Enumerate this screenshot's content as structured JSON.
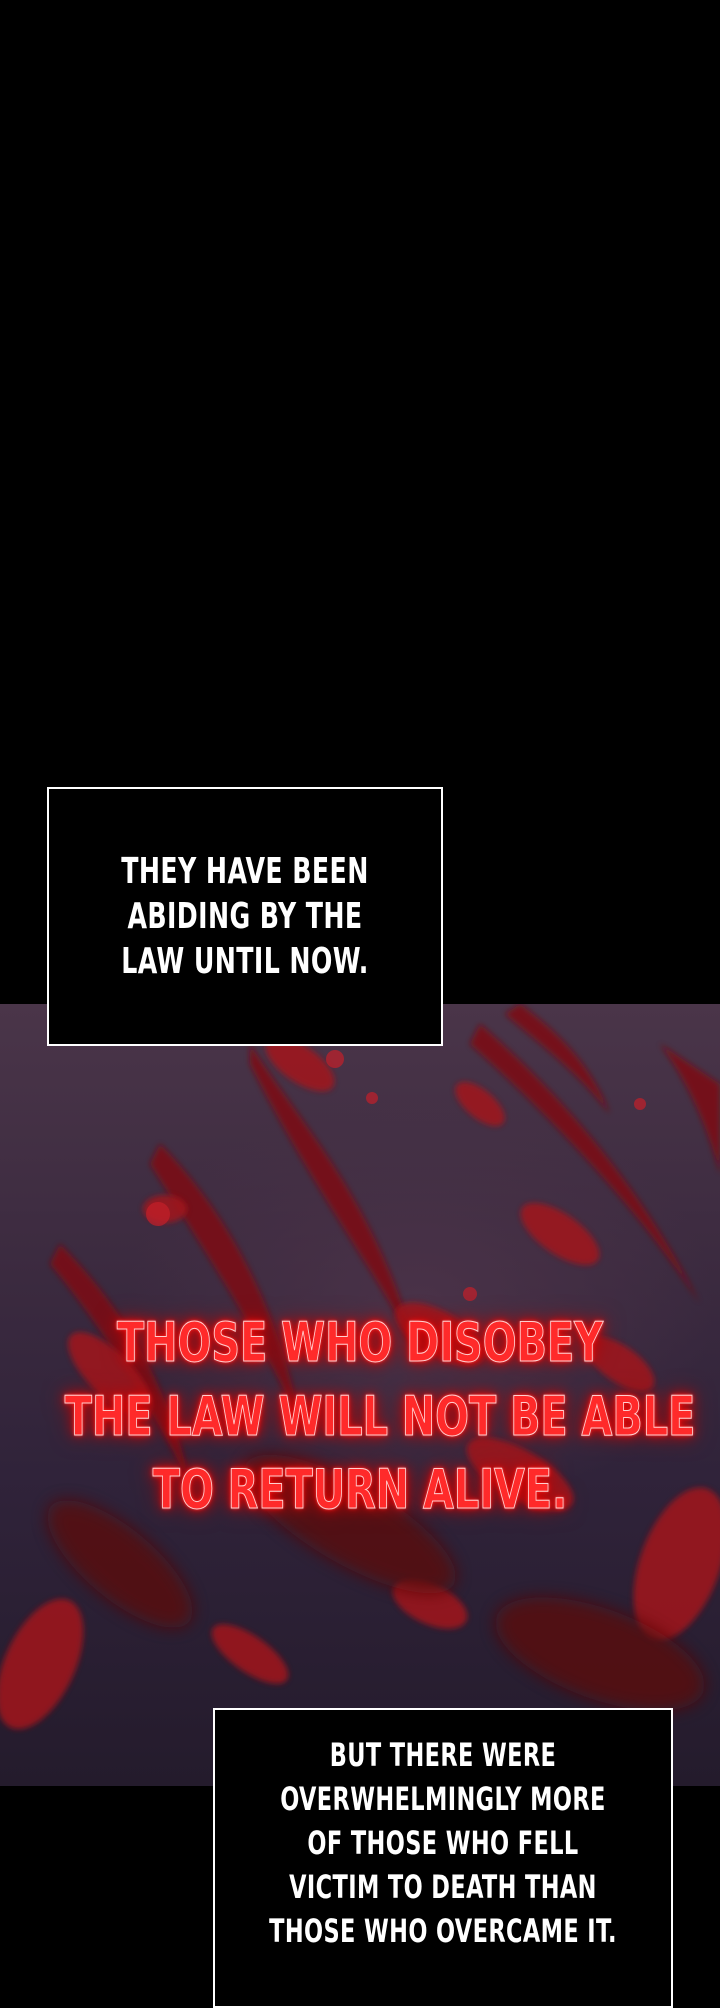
{
  "panels": {
    "narration_1": {
      "text": "THEY HAVE BEEN ABIDING BY THE LAW UNTIL NOW."
    },
    "warning": {
      "lines": [
        "THOSE WHO DISOBEY",
        "THE LAW WILL NOT BE ABLE",
        "TO RETURN ALIVE."
      ],
      "color": "#ff2a2a"
    },
    "narration_2": {
      "text": "BUT THERE WERE OVERWHELMINGLY MORE OF THOSE WHO FELL VICTIM TO DEATH THAN THOSE WHO OVERCAME IT."
    }
  },
  "colors": {
    "background": "#000000",
    "panel_bg": "#3b2a3f",
    "blood": "#8a0f14"
  }
}
